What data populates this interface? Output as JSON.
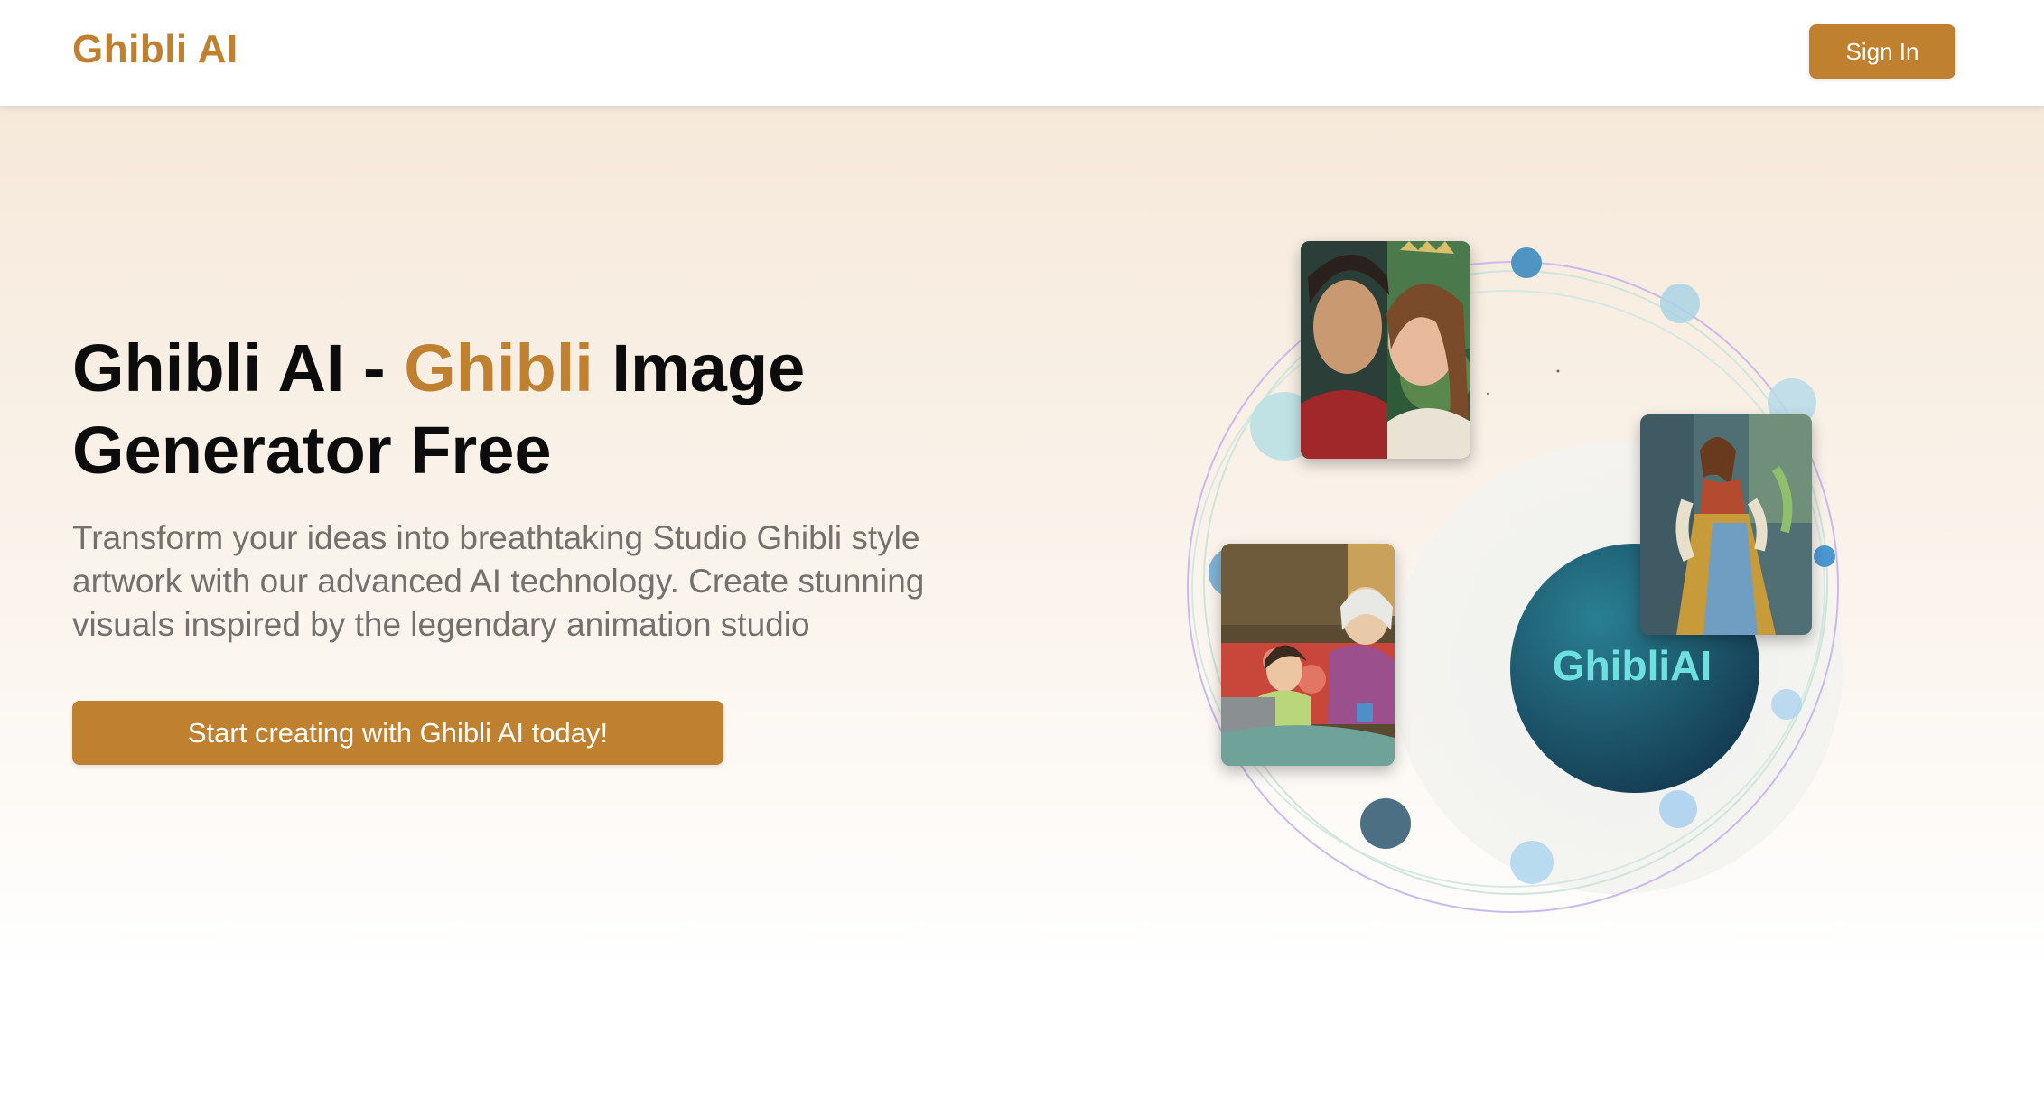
{
  "header": {
    "logo": "Ghibli AI",
    "sign_in_label": "Sign In"
  },
  "hero": {
    "title_part1": "Ghibli AI - ",
    "title_accent": "Ghibli",
    "title_part2": " Image Generator Free",
    "subtitle": "Transform your ideas into breathtaking Studio Ghibli style artwork with our advanced AI technology. Create stunning visuals inspired by the legendary animation studio",
    "cta_label": "Start creating with Ghibli AI today!"
  },
  "visual": {
    "center_label": "GhibliAI",
    "images": [
      "couple-portrait",
      "grandmother-family-scene",
      "princess-in-gown"
    ]
  },
  "colors": {
    "accent": "#bf8030",
    "hero_bg_top": "#f6e9da",
    "circle_teal": "#1f5f78",
    "label_cyan": "#6fe0e0"
  }
}
